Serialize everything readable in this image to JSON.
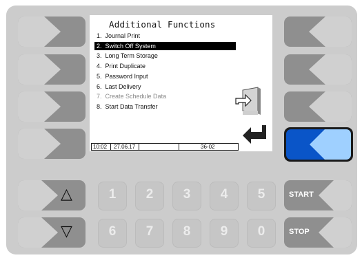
{
  "colors": {
    "panel": "#cccccc",
    "button": "#8f8f8f",
    "active_button": "#0a55c8",
    "active_chevron": "#9fd0ff",
    "screen": "#ffffff"
  },
  "screen": {
    "title": "Additional Functions",
    "menu": [
      {
        "num": "1.",
        "label": "Journal Print",
        "state": "normal"
      },
      {
        "num": "2.",
        "label": "Switch Off System",
        "state": "selected"
      },
      {
        "num": "3.",
        "label": "Long Term Storage",
        "state": "normal"
      },
      {
        "num": "4.",
        "label": "Print Duplicate",
        "state": "normal"
      },
      {
        "num": "5.",
        "label": "Password Input",
        "state": "normal"
      },
      {
        "num": "6.",
        "label": "Last Delivery",
        "state": "normal"
      },
      {
        "num": "7.",
        "label": "Create Schedule Data",
        "state": "disabled"
      },
      {
        "num": "8.",
        "label": "Start Data Transfer",
        "state": "normal"
      }
    ],
    "status": {
      "time": "10:02",
      "date": "27.06.17",
      "code": "36-02"
    },
    "icons": [
      "exit-door-icon",
      "enter-return-arrow-icon"
    ]
  },
  "keys": {
    "up": "△",
    "down": "▽",
    "numbers": [
      "1",
      "2",
      "3",
      "4",
      "5",
      "6",
      "7",
      "8",
      "9",
      "0"
    ],
    "start": "START",
    "stop": "STOP"
  }
}
